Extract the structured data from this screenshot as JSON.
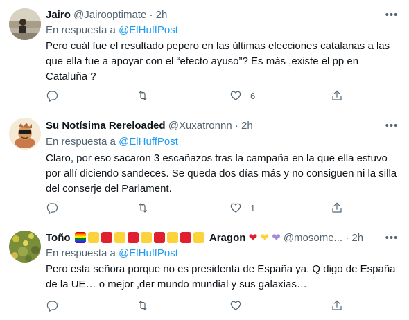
{
  "tweets": [
    {
      "name": "Jairo",
      "handle": "@Jairooptimate",
      "dot": "·",
      "time": "2h",
      "reply_prefix": "En respuesta a",
      "reply_mention": "@ElHuffPost",
      "text": "Pero cuál fue el resultado pepero en las últimas elecciones catalanas a las que ella fue a apoyar con el “efecto ayuso”? Es más ,existe el pp en Cataluña ?",
      "like_count": "6",
      "reply_count": "",
      "retweet_count": ""
    },
    {
      "name": "Su Notísima Rereloaded",
      "handle": "@Xuxatronnn",
      "dot": "·",
      "time": "2h",
      "reply_prefix": "En respuesta a",
      "reply_mention": "@ElHuffPost",
      "text": "Claro, por eso sacaron 3 escañazos tras la campaña en la que ella estuvo por allí diciendo sandeces. Se queda dos días más y no consiguen ni la silla del conserje del Parlament.",
      "like_count": "1",
      "reply_count": "",
      "retweet_count": ""
    },
    {
      "name_prefix": "Toño",
      "name_suffix": "Aragon",
      "handle": "@mosome...",
      "dot": "·",
      "time": "2h",
      "reply_prefix": "En respuesta a",
      "reply_mention": "@ElHuffPost",
      "text": "Pero esta señora porque no es presidenta de España ya. Q digo de España de  la UE… o mejor ,der mundo mundial y sus galaxias…",
      "like_count": "",
      "reply_count": "",
      "retweet_count": ""
    }
  ],
  "colors": {
    "text": "#0f1419",
    "secondary": "#536471",
    "link": "#1d9bf0",
    "divider": "#eff3f4",
    "aragon_yellow": "#fcd33b",
    "aragon_red": "#e0202e",
    "heart_red": "#e0202e",
    "heart_yellow": "#fcd33b",
    "heart_purple": "#a78bdb"
  },
  "icons": {
    "reply": "reply-icon",
    "retweet": "retweet-icon",
    "like": "like-icon",
    "share": "share-icon",
    "more": "more-icon"
  }
}
